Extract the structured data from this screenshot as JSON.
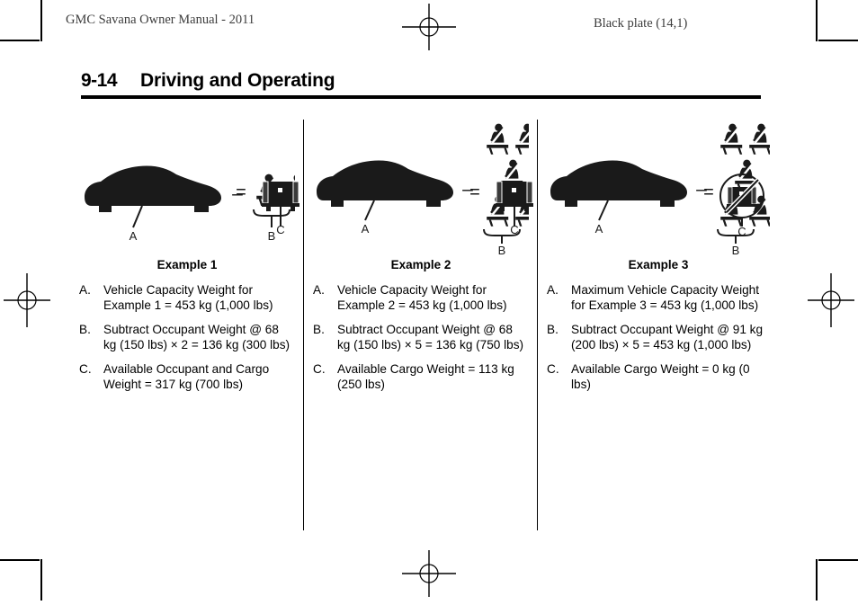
{
  "header": {
    "manual_title": "GMC Savana Owner Manual - 2011",
    "plate_note": "Black plate (14,1)"
  },
  "page": {
    "number": "9-14",
    "section_title": "Driving and Operating"
  },
  "icons": {
    "car": "car-silhouette-icon",
    "occupant": "seated-occupant-seatbelt-icon",
    "cargo": "cargo-box-icon",
    "cargo_prohibited": "cargo-box-prohibited-icon",
    "minus": "minus-sign",
    "equals": "equals-sign",
    "registration": "registration-crosshair-mark"
  },
  "columns": [
    {
      "title": "Example 1",
      "diagram": {
        "car_label": "A",
        "occupants_label": "B",
        "cargo_label": "C",
        "occupant_count": 2,
        "minus": "–",
        "equals": "=",
        "cargo_prohibited": false
      },
      "items": [
        {
          "label": "A.",
          "text": "Vehicle Capacity Weight for Example 1 = 453 kg (1,000 lbs)"
        },
        {
          "label": "B.",
          "text": "Subtract Occupant Weight @ 68 kg (150 lbs) × 2 = 136 kg (300 lbs)"
        },
        {
          "label": "C.",
          "text": "Available Occupant and Cargo Weight = 317 kg (700 lbs)"
        }
      ]
    },
    {
      "title": "Example 2",
      "diagram": {
        "car_label": "A",
        "occupants_label": "B",
        "cargo_label": "C",
        "occupant_count": 5,
        "minus": "–",
        "equals": "=",
        "cargo_prohibited": false
      },
      "items": [
        {
          "label": "A.",
          "text": "Vehicle Capacity Weight for Example 2 = 453 kg (1,000 lbs)"
        },
        {
          "label": "B.",
          "text": "Subtract Occupant Weight @ 68 kg (150 lbs) × 5 = 136 kg (750 lbs)"
        },
        {
          "label": "C.",
          "text": "Available Cargo Weight = 113 kg (250 lbs)"
        }
      ]
    },
    {
      "title": "Example 3",
      "diagram": {
        "car_label": "A",
        "occupants_label": "B",
        "cargo_label": "C",
        "occupant_count": 5,
        "minus": "–",
        "equals": "=",
        "cargo_prohibited": true
      },
      "items": [
        {
          "label": "A.",
          "text": "Maximum Vehicle Capacity Weight for Example 3 = 453 kg (1,000 lbs)"
        },
        {
          "label": "B.",
          "text": "Subtract Occupant Weight @ 91 kg (200 lbs) × 5 = 453 kg (1,000 lbs)"
        },
        {
          "label": "C.",
          "text": "Available Cargo Weight = 0 kg (0 lbs)"
        }
      ]
    }
  ]
}
